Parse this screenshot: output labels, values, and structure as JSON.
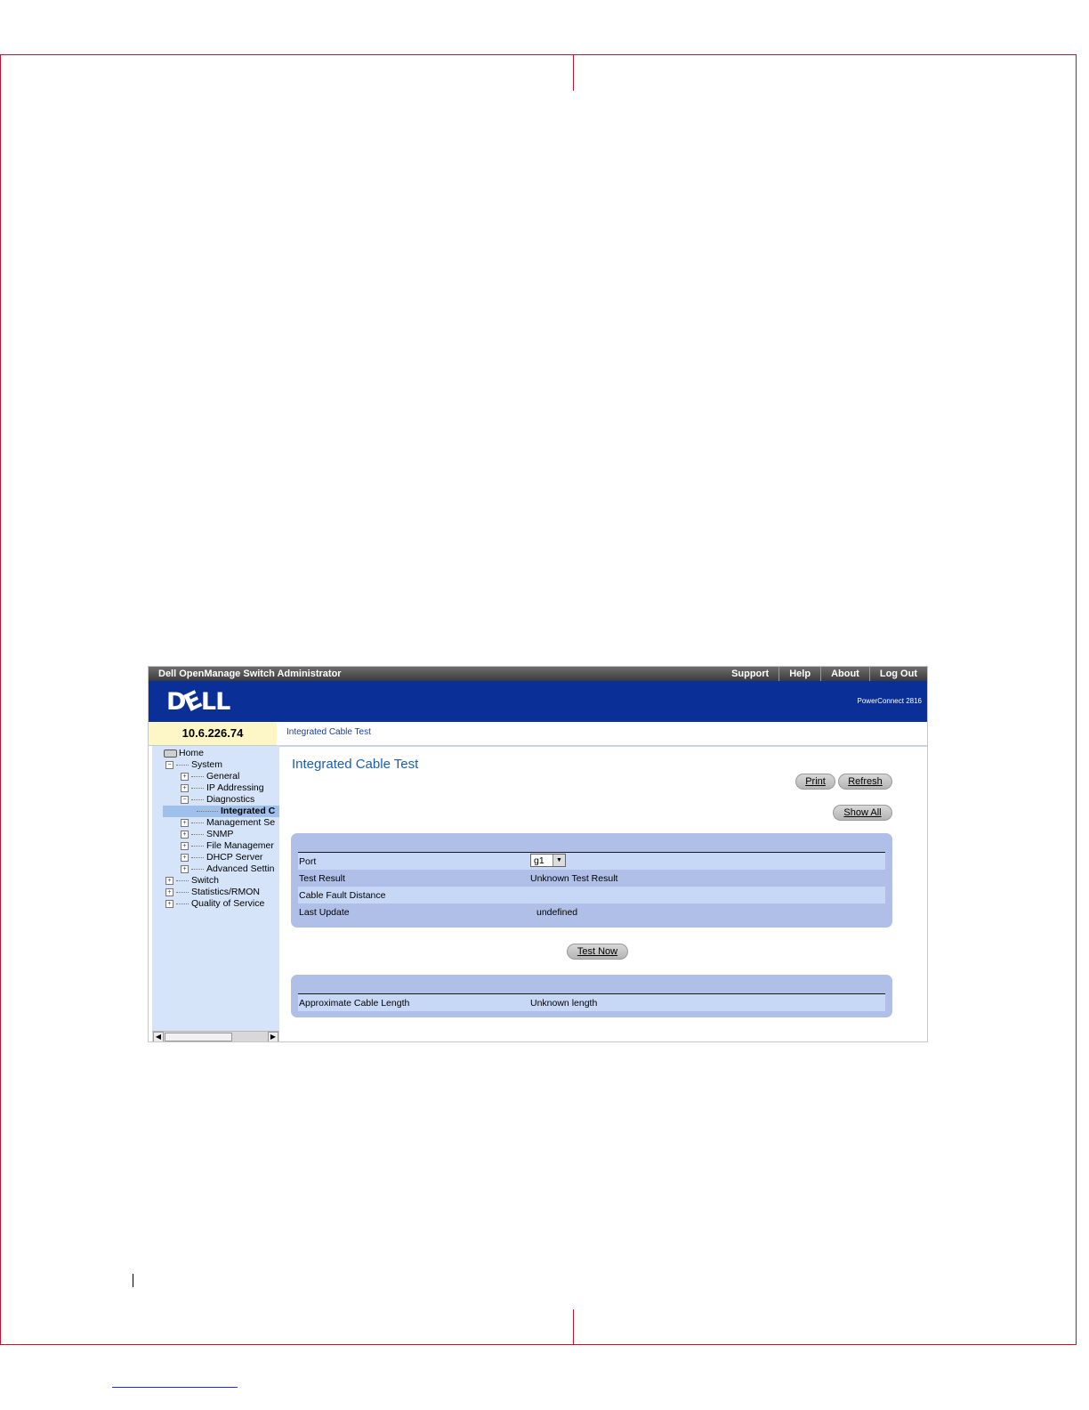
{
  "app": {
    "title": "Dell OpenManage Switch Administrator",
    "nav": [
      "Support",
      "Help",
      "About",
      "Log Out"
    ],
    "logo_text": "DELL",
    "product": "PowerConnect 2816",
    "ip": "10.6.226.74",
    "breadcrumb": "Integrated Cable Test"
  },
  "tree": {
    "home": "Home",
    "system": "System",
    "general": "General",
    "ip_addressing": "IP Addressing",
    "diagnostics": "Diagnostics",
    "integrated": "Integrated C",
    "management": "Management Se",
    "snmp": "SNMP",
    "file_management": "File Managemer",
    "dhcp_server": "DHCP Server",
    "advanced": "Advanced Settin",
    "switch": "Switch",
    "statistics": "Statistics/RMON",
    "qos": "Quality of Service"
  },
  "main": {
    "title": "Integrated Cable Test",
    "print": "Print",
    "refresh": "Refresh",
    "show_all": "Show All",
    "test_now": "Test Now",
    "port_label": "Port",
    "port_value": "g1",
    "test_result_label": "Test Result",
    "test_result_value": "Unknown Test Result",
    "fault_distance_label": "Cable Fault Distance",
    "last_update_label": "Last Update",
    "last_update_value": "undefined",
    "cable_length_label": "Approximate Cable Length",
    "cable_length_value": "Unknown length"
  },
  "colors": {
    "banner": "#0a2f96",
    "panel": "#b0bfe8",
    "tree_bg": "#d5e4f8",
    "title": "#1a5fb4",
    "crop_marks": "#c8102e"
  }
}
